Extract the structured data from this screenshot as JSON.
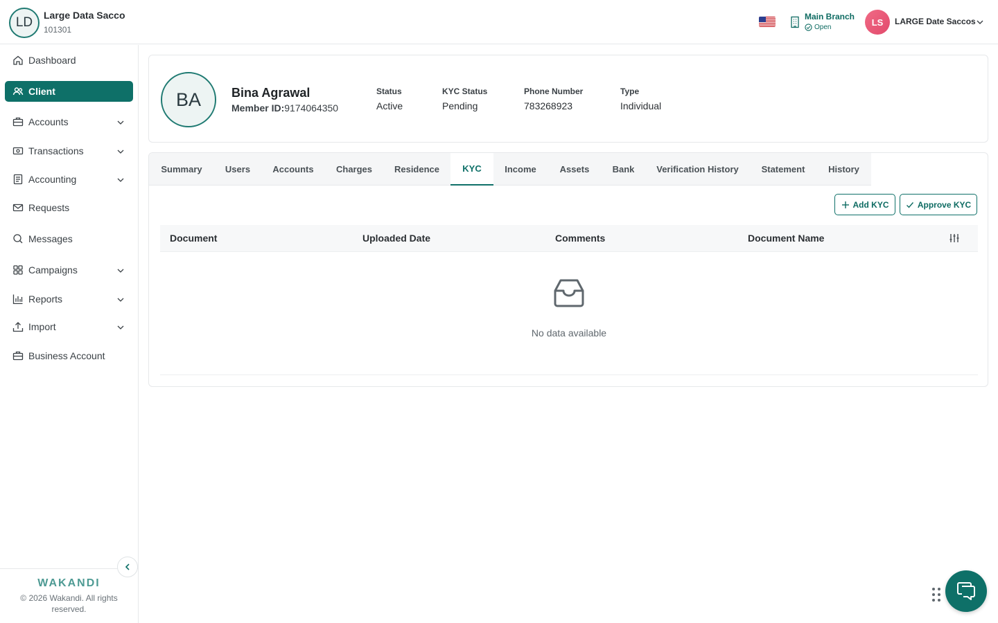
{
  "header": {
    "org_initials": "LD",
    "org_name": "Large Data Sacco",
    "org_code": "101301",
    "branch_name": "Main Branch",
    "branch_status": "Open",
    "user_initials": "LS",
    "user_name": "LARGE Date Saccos"
  },
  "sidebar": {
    "items": [
      {
        "label": "Dashboard",
        "icon": "home-icon"
      },
      {
        "label": "Client",
        "icon": "users-icon"
      },
      {
        "label": "Accounts",
        "icon": "briefcase-icon"
      },
      {
        "label": "Transactions",
        "icon": "cash-icon"
      },
      {
        "label": "Accounting",
        "icon": "ledger-icon"
      },
      {
        "label": "Requests",
        "icon": "mail-icon"
      },
      {
        "label": "Messages",
        "icon": "chat-search-icon"
      },
      {
        "label": "Campaigns",
        "icon": "grid-icon"
      },
      {
        "label": "Reports",
        "icon": "bar-chart-icon"
      },
      {
        "label": "Import",
        "icon": "upload-icon"
      },
      {
        "label": "Business Account",
        "icon": "briefcase-icon"
      }
    ],
    "active": "Client",
    "brand": "WAKANDI",
    "copyright": "© 2026 Wakandi. All rights reserved."
  },
  "client": {
    "initials": "BA",
    "name": "Bina Agrawal",
    "member_id_label": "Member ID:",
    "member_id": "9174064350",
    "stats": [
      {
        "label": "Status",
        "value": "Active"
      },
      {
        "label": "KYC Status",
        "value": "Pending"
      },
      {
        "label": "Phone Number",
        "value": "783268923"
      },
      {
        "label": "Type",
        "value": "Individual"
      }
    ]
  },
  "tabs": [
    "Summary",
    "Users",
    "Accounts",
    "Charges",
    "Residence",
    "KYC",
    "Income",
    "Assets",
    "Bank",
    "Verification History",
    "Statement",
    "History"
  ],
  "active_tab": "KYC",
  "kyc": {
    "add_label": "Add KYC",
    "approve_label": "Approve KYC",
    "columns": [
      "Document",
      "Uploaded Date",
      "Comments",
      "Document Name"
    ],
    "empty_text": "No data available"
  },
  "colors": {
    "accent": "#0e7068",
    "avatar_pink": "#e24a6c"
  }
}
